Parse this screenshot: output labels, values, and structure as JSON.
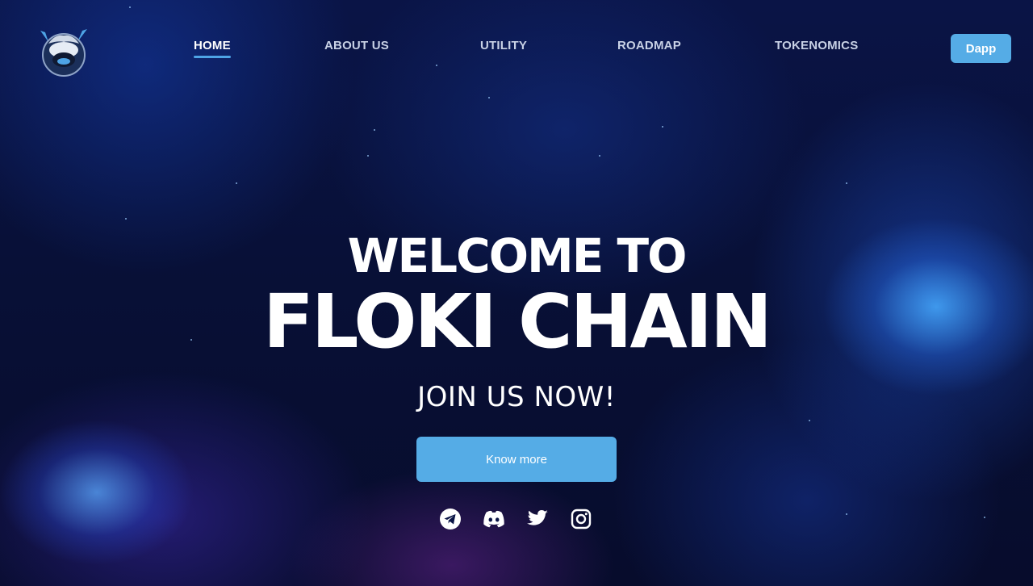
{
  "nav": {
    "items": [
      {
        "label": "HOME",
        "active": true
      },
      {
        "label": "ABOUT US",
        "active": false
      },
      {
        "label": "UTILITY",
        "active": false
      },
      {
        "label": "ROADMAP",
        "active": false
      },
      {
        "label": "TOKENOMICS",
        "active": false
      }
    ],
    "dapp_label": "Dapp"
  },
  "hero": {
    "line1": "WELCOME TO",
    "line2": "FLOKI CHAIN",
    "subtitle": "JOIN US NOW!",
    "cta_label": "Know more"
  },
  "socials": [
    {
      "icon": "telegram-icon"
    },
    {
      "icon": "discord-icon"
    },
    {
      "icon": "twitter-icon"
    },
    {
      "icon": "instagram-icon"
    }
  ],
  "colors": {
    "accent": "#55ace6",
    "background": "#081037",
    "nav_text": "#c9d2e6",
    "active_underline": "#4ea4e6"
  }
}
